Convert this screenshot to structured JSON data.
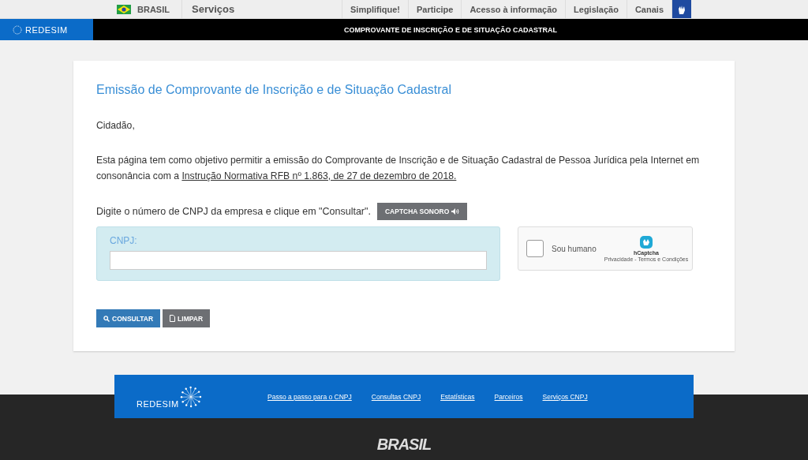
{
  "top_bar": {
    "country": "BRASIL",
    "services": "Serviços",
    "links": [
      "Simplifique!",
      "Participe",
      "Acesso à informação",
      "Legislação",
      "Canais"
    ]
  },
  "header": {
    "logo": "REDESIM",
    "title": "COMPROVANTE DE INSCRIÇÃO E DE SITUAÇÃO CADASTRAL"
  },
  "card": {
    "heading": "Emissão de Comprovante de Inscrição e de Situação Cadastral",
    "greeting": "Cidadão,",
    "intro": "Esta página tem como objetivo permitir a emissão do Comprovante de Inscrição e de Situação Cadastral de Pessoa Jurídica pela Internet em consonância com a",
    "intro_link": "Instrução Normativa RFB nº 1.863, de 27 de dezembro de 2018.",
    "instruction": "Digite o número de CNPJ da empresa e clique em \"Consultar\".",
    "audio_button": "CAPTCHA SONORO",
    "cnpj_label": "CNPJ:",
    "captcha": {
      "label": "Sou humano",
      "checked": false,
      "brand": "hCaptcha",
      "footer": "Privacidade - Termos e Condições"
    },
    "buttons": [
      {
        "kind": "primary",
        "label": "CONSULTAR"
      },
      {
        "kind": "secondary",
        "label": "LIMPAR"
      }
    ]
  },
  "footer": {
    "logo": "REDESIM",
    "links": [
      "Passo a passo para o CNPJ",
      "Consultas CNPJ",
      "Estatísticas",
      "Parceiros",
      "Serviços CNPJ"
    ],
    "emblem": "BRASIL"
  }
}
